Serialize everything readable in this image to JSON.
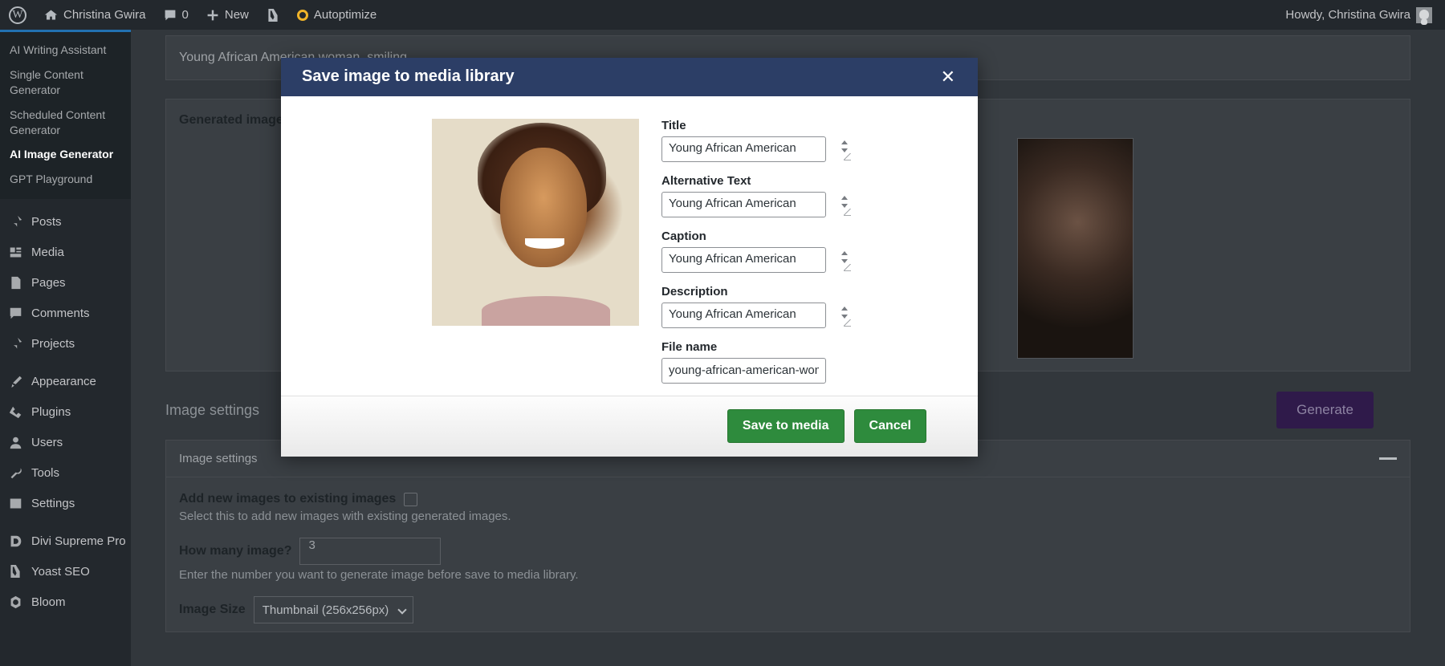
{
  "adminbar": {
    "logo_icon": "wordpress-logo-icon",
    "site_icon": "home-icon",
    "site_name": "Christina Gwira",
    "comments_icon": "comment-bubble-icon",
    "comments_count": "0",
    "new_icon": "plus-icon",
    "new_label": "New",
    "yoast_icon": "yoast-seo-icon",
    "autoptimize_icon": "autoptimize-ring-icon",
    "autoptimize_label": "Autoptimize",
    "howdy": "Howdy, Christina Gwira",
    "avatar_icon": "user-avatar-icon"
  },
  "sidebar": {
    "submenu": [
      {
        "label": "AI Writing Assistant",
        "current": false
      },
      {
        "label": "Single Content Generator",
        "current": false
      },
      {
        "label": "Scheduled Content Generator",
        "current": false
      },
      {
        "label": "AI Image Generator",
        "current": true
      },
      {
        "label": "GPT Playground",
        "current": false
      }
    ],
    "items": [
      {
        "label": "Posts",
        "icon": "pin-icon"
      },
      {
        "label": "Media",
        "icon": "media-icon"
      },
      {
        "label": "Pages",
        "icon": "page-icon"
      },
      {
        "label": "Comments",
        "icon": "comment-bubble-icon"
      },
      {
        "label": "Projects",
        "icon": "pin-icon"
      },
      {
        "label": "Appearance",
        "icon": "paintbrush-icon"
      },
      {
        "label": "Plugins",
        "icon": "plug-icon"
      },
      {
        "label": "Users",
        "icon": "user-icon"
      },
      {
        "label": "Tools",
        "icon": "wrench-icon"
      },
      {
        "label": "Settings",
        "icon": "sliders-icon"
      },
      {
        "label": "Divi Supreme Pro",
        "icon": "divi-supreme-icon"
      },
      {
        "label": "Yoast SEO",
        "icon": "yoast-seo-icon"
      },
      {
        "label": "Bloom",
        "icon": "bloom-flower-icon"
      }
    ]
  },
  "main": {
    "prompt_value": "Young African American woman, smiling",
    "generated_images_title": "Generated images",
    "image_settings_heading": "Image settings",
    "generate_button": "Generate",
    "settings_panel_title": "Image settings",
    "collapse_icon": "minus-icon",
    "add_new_label": "Add new images to existing images",
    "add_new_hint": "Select this to add new images with existing generated images.",
    "how_many_label": "How many image?",
    "how_many_value": "3",
    "how_many_hint": "Enter the number you want to generate image before save to media library.",
    "image_size_label": "Image Size",
    "image_size_value": "Thumbnail (256x256px)",
    "image_size_caret_icon": "chevron-down-icon"
  },
  "modal": {
    "title": "Save image to media library",
    "close_icon": "close-icon",
    "preview_alt": "generated-image-preview",
    "fields": [
      {
        "label": "Title",
        "value": "Young African American",
        "name": "title"
      },
      {
        "label": "Alternative Text",
        "value": "Young African American",
        "name": "alt-text"
      },
      {
        "label": "Caption",
        "value": "Young African American",
        "name": "caption"
      },
      {
        "label": "Description",
        "value": "Young African American",
        "name": "description"
      }
    ],
    "file_name_label": "File name",
    "file_name_value": "young-african-american-woman-smiling",
    "save_button": "Save to media",
    "cancel_button": "Cancel"
  },
  "colors": {
    "admin_bar": "#23282d",
    "modal_header": "#2c3e66",
    "green_button": "#2e8b3d",
    "generate_button": "#2f1a4a"
  }
}
